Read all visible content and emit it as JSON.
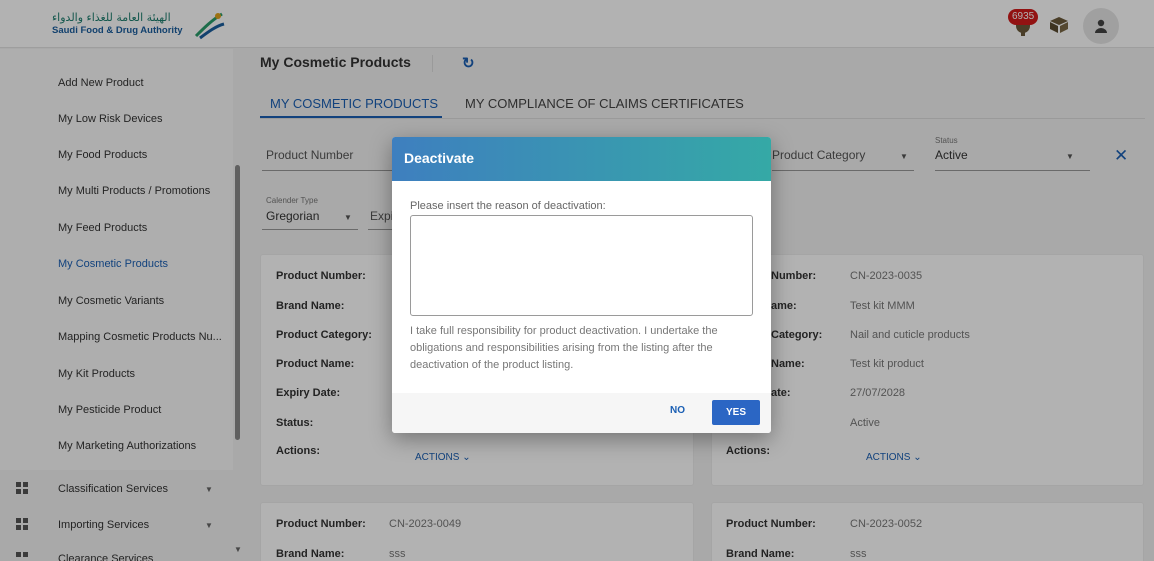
{
  "header": {
    "logo_ar": "الهيئة العامة للغذاء والدواء",
    "logo_en": "Saudi Food & Drug Authority",
    "notification_count": "6935"
  },
  "sidebar": {
    "items": [
      {
        "label": "Add New Product"
      },
      {
        "label": "My Low Risk Devices"
      },
      {
        "label": "My Food Products"
      },
      {
        "label": "My Multi Products / Promotions"
      },
      {
        "label": "My Feed Products"
      },
      {
        "label": "My Cosmetic Products"
      },
      {
        "label": "My Cosmetic Variants"
      },
      {
        "label": "Mapping Cosmetic Products Nu..."
      },
      {
        "label": "My Kit Products"
      },
      {
        "label": "My Pesticide Product"
      },
      {
        "label": "My Marketing Authorizations"
      }
    ],
    "sections": [
      {
        "label": "Classification Services"
      },
      {
        "label": "Importing Services"
      },
      {
        "label": "Clearance Services"
      }
    ]
  },
  "main": {
    "title": "My Cosmetic Products",
    "tabs": [
      {
        "label": "MY COSMETIC PRODUCTS"
      },
      {
        "label": "MY COMPLIANCE OF CLAIMS CERTIFICATES"
      }
    ],
    "filters": {
      "product_number_placeholder": "Product Number",
      "product_category_placeholder": "Product Category",
      "status_label": "Status",
      "status_value": "Active",
      "calendar_label": "Calender Type",
      "calendar_value": "Gregorian",
      "expiry_placeholder": "Expi"
    },
    "card_labels": {
      "product_number": "Product Number:",
      "brand_name": "Brand Name:",
      "product_category": "Product Category:",
      "product_name": "Product Name:",
      "expiry_date": "Expiry Date:",
      "status": "Status:",
      "actions": "Actions:",
      "actions_button": "ACTIONS ⌄"
    },
    "right_card_labels": {
      "product_number": "Number:",
      "brand_name": "ame:",
      "product_category": "Category:",
      "product_name": "Name:",
      "expiry_date": "ate:"
    },
    "cards": [
      {
        "product_number": "CN-2023-0035",
        "brand_name": "Test kit MMM",
        "product_category": "Nail and cuticle products",
        "product_name": "Test kit product",
        "expiry_date": "27/07/2028",
        "status": "Active"
      },
      {
        "product_number": "CN-2023-0049",
        "brand_name": "sss"
      },
      {
        "product_number": "CN-2023-0052",
        "brand_name": "sss"
      }
    ]
  },
  "dialog": {
    "title": "Deactivate",
    "prompt": "Please insert the reason of deactivation:",
    "textarea_value": "",
    "disclaimer": "I take full responsibility for product deactivation. I undertake the obligations and responsibilities arising from the listing after the deactivation of the product listing.",
    "no_label": "NO",
    "yes_label": "YES"
  },
  "colors": {
    "accent": "#1a5fb4",
    "header_gradient_start": "#3e7fbf",
    "header_gradient_end": "#35a9a6",
    "badge": "#d11a1a"
  },
  "icons": {
    "refresh": "refresh-icon",
    "notification": "trophy-bell-icon",
    "package": "package-icon",
    "user": "user-icon",
    "close": "close-icon",
    "grid": "grid-icon"
  }
}
